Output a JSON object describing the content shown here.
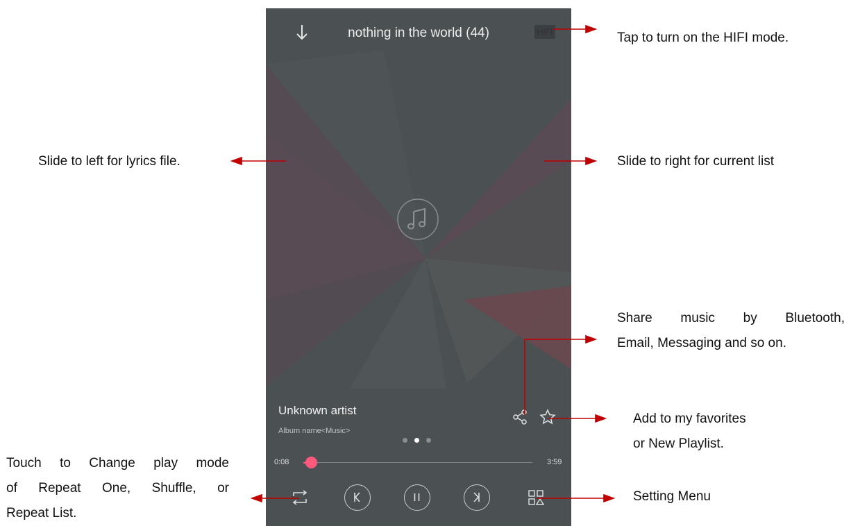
{
  "annotations": {
    "hifi": "Tap to turn on the HIFI mode.",
    "slide_left": "Slide to left for lyrics file.",
    "slide_right": "Slide to right for current list",
    "share_line1": "Share music by Bluetooth,",
    "share_line2": "Email, Messaging and so on.",
    "favorites_line1": "Add to my favorites",
    "favorites_line2": "or New Playlist.",
    "playmode_line1": "Touch to Change play mode",
    "playmode_line2": "of Repeat One, Shuffle, or",
    "playmode_line3": "Repeat List.",
    "setting": "Setting Menu"
  },
  "player": {
    "title": "nothing in the world (44)",
    "hifi_badge": "HIFI",
    "artist": "Unknown artist",
    "album": "Album name<Music>",
    "current_time": "0:08",
    "total_time": "3:59",
    "progress": 0.034,
    "page_dots": 3,
    "active_dot": 1
  },
  "icons": {
    "collapse": "arrow-down-icon",
    "album_art": "music-note-icon",
    "share": "share-icon",
    "favorite": "star-icon",
    "play_mode": "repeat-icon",
    "previous": "previous-icon",
    "pause": "pause-icon",
    "next": "next-icon",
    "menu": "menu-grid-icon"
  },
  "colors": {
    "accent": "#ff5a7d",
    "annotation_arrow": "#c00000",
    "background": "#4b5052"
  }
}
